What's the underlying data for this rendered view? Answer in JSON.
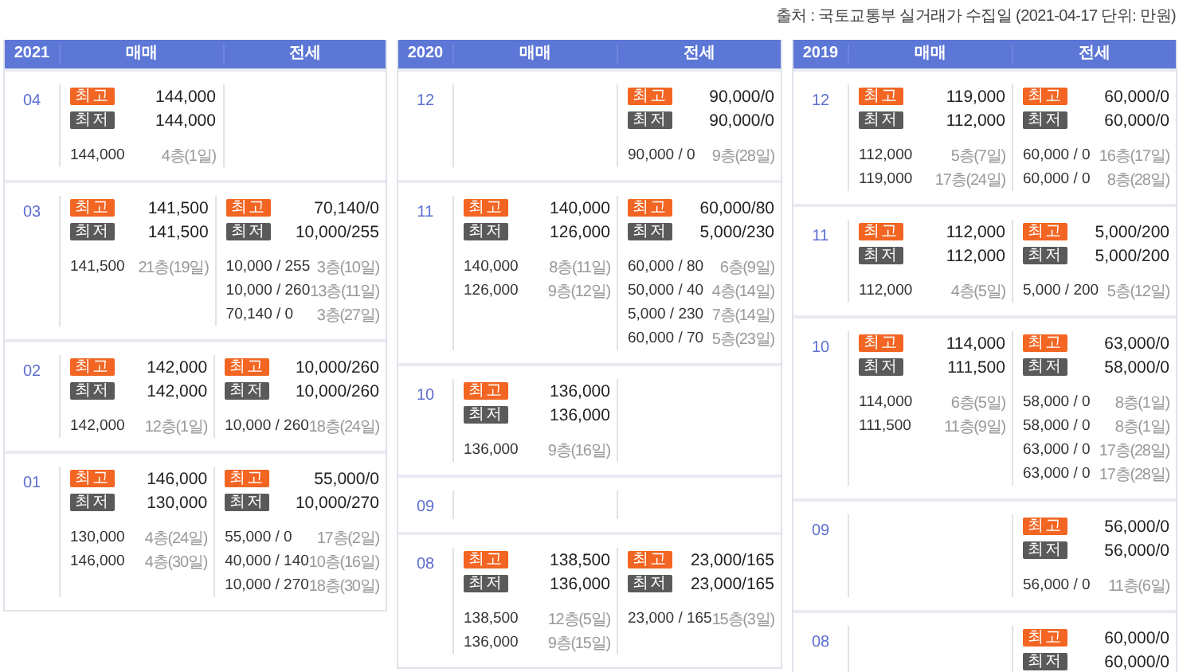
{
  "source": "출처 : 국토교통부 실거래가 수집일 (2021-04-17 단위: 만원)",
  "panels": [
    {
      "header": {
        "year": "2021",
        "sale": "매매",
        "rent": "전세"
      },
      "months": [
        {
          "month": "04",
          "sale": {
            "badges": [
              {
                "kind": "high",
                "label": "최고",
                "value": "144,000"
              },
              {
                "kind": "low",
                "label": "최저",
                "value": "144,000"
              }
            ],
            "deals": [
              {
                "price": "144,000",
                "floor": "4층(1일)"
              }
            ]
          }
        },
        {
          "month": "03",
          "sale": {
            "badges": [
              {
                "kind": "high",
                "label": "최고",
                "value": "141,500"
              },
              {
                "kind": "low",
                "label": "최저",
                "value": "141,500"
              }
            ],
            "deals": [
              {
                "price": "141,500",
                "floor": "21층(19일)"
              }
            ]
          },
          "rent": {
            "badges": [
              {
                "kind": "high",
                "label": "최고",
                "value": "70,140/0"
              },
              {
                "kind": "low",
                "label": "최저",
                "value": "10,000/255"
              }
            ],
            "deals": [
              {
                "price": "10,000 / 255",
                "floor": "3층(10일)"
              },
              {
                "price": "10,000 / 260",
                "floor": "13층(11일)"
              },
              {
                "price": "70,140 / 0",
                "floor": "3층(27일)"
              }
            ]
          }
        },
        {
          "month": "02",
          "sale": {
            "badges": [
              {
                "kind": "high",
                "label": "최고",
                "value": "142,000"
              },
              {
                "kind": "low",
                "label": "최저",
                "value": "142,000"
              }
            ],
            "deals": [
              {
                "price": "142,000",
                "floor": "12층(1일)"
              }
            ]
          },
          "rent": {
            "badges": [
              {
                "kind": "high",
                "label": "최고",
                "value": "10,000/260"
              },
              {
                "kind": "low",
                "label": "최저",
                "value": "10,000/260"
              }
            ],
            "deals": [
              {
                "price": "10,000 / 260",
                "floor": "18층(24일)"
              }
            ]
          }
        },
        {
          "month": "01",
          "sale": {
            "badges": [
              {
                "kind": "high",
                "label": "최고",
                "value": "146,000"
              },
              {
                "kind": "low",
                "label": "최저",
                "value": "130,000"
              }
            ],
            "deals": [
              {
                "price": "130,000",
                "floor": "4층(24일)"
              },
              {
                "price": "146,000",
                "floor": "4층(30일)"
              }
            ]
          },
          "rent": {
            "badges": [
              {
                "kind": "high",
                "label": "최고",
                "value": "55,000/0"
              },
              {
                "kind": "low",
                "label": "최저",
                "value": "10,000/270"
              }
            ],
            "deals": [
              {
                "price": "55,000 / 0",
                "floor": "17층(2일)"
              },
              {
                "price": "40,000 / 140",
                "floor": "10층(16일)"
              },
              {
                "price": "10,000 / 270",
                "floor": "18층(30일)"
              }
            ]
          }
        }
      ]
    },
    {
      "header": {
        "year": "2020",
        "sale": "매매",
        "rent": "전세"
      },
      "months": [
        {
          "month": "12",
          "rent": {
            "badges": [
              {
                "kind": "high",
                "label": "최고",
                "value": "90,000/0"
              },
              {
                "kind": "low",
                "label": "최저",
                "value": "90,000/0"
              }
            ],
            "deals": [
              {
                "price": "90,000 / 0",
                "floor": "9층(28일)"
              }
            ]
          }
        },
        {
          "month": "11",
          "sale": {
            "badges": [
              {
                "kind": "high",
                "label": "최고",
                "value": "140,000"
              },
              {
                "kind": "low",
                "label": "최저",
                "value": "126,000"
              }
            ],
            "deals": [
              {
                "price": "140,000",
                "floor": "8층(11일)"
              },
              {
                "price": "126,000",
                "floor": "9층(12일)"
              }
            ]
          },
          "rent": {
            "badges": [
              {
                "kind": "high",
                "label": "최고",
                "value": "60,000/80"
              },
              {
                "kind": "low",
                "label": "최저",
                "value": "5,000/230"
              }
            ],
            "deals": [
              {
                "price": "60,000 / 80",
                "floor": "6층(9일)"
              },
              {
                "price": "50,000 / 40",
                "floor": "4층(14일)"
              },
              {
                "price": "5,000 / 230",
                "floor": "7층(14일)"
              },
              {
                "price": "60,000 / 70",
                "floor": "5층(23일)"
              }
            ]
          }
        },
        {
          "month": "10",
          "sale": {
            "badges": [
              {
                "kind": "high",
                "label": "최고",
                "value": "136,000"
              },
              {
                "kind": "low",
                "label": "최저",
                "value": "136,000"
              }
            ],
            "deals": [
              {
                "price": "136,000",
                "floor": "9층(16일)"
              }
            ]
          }
        },
        {
          "month": "09"
        },
        {
          "month": "08",
          "sale": {
            "badges": [
              {
                "kind": "high",
                "label": "최고",
                "value": "138,500"
              },
              {
                "kind": "low",
                "label": "최저",
                "value": "136,000"
              }
            ],
            "deals": [
              {
                "price": "138,500",
                "floor": "12층(5일)"
              },
              {
                "price": "136,000",
                "floor": "9층(15일)"
              }
            ]
          },
          "rent": {
            "badges": [
              {
                "kind": "high",
                "label": "최고",
                "value": "23,000/165"
              },
              {
                "kind": "low",
                "label": "최저",
                "value": "23,000/165"
              }
            ],
            "deals": [
              {
                "price": "23,000 / 165",
                "floor": "15층(3일)"
              }
            ]
          }
        }
      ]
    },
    {
      "header": {
        "year": "2019",
        "sale": "매매",
        "rent": "전세"
      },
      "months": [
        {
          "month": "12",
          "sale": {
            "badges": [
              {
                "kind": "high",
                "label": "최고",
                "value": "119,000"
              },
              {
                "kind": "low",
                "label": "최저",
                "value": "112,000"
              }
            ],
            "deals": [
              {
                "price": "112,000",
                "floor": "5층(7일)"
              },
              {
                "price": "119,000",
                "floor": "17층(24일)"
              }
            ]
          },
          "rent": {
            "badges": [
              {
                "kind": "high",
                "label": "최고",
                "value": "60,000/0"
              },
              {
                "kind": "low",
                "label": "최저",
                "value": "60,000/0"
              }
            ],
            "deals": [
              {
                "price": "60,000 / 0",
                "floor": "16층(17일)"
              },
              {
                "price": "60,000 / 0",
                "floor": "8층(28일)"
              }
            ]
          }
        },
        {
          "month": "11",
          "sale": {
            "badges": [
              {
                "kind": "high",
                "label": "최고",
                "value": "112,000"
              },
              {
                "kind": "low",
                "label": "최저",
                "value": "112,000"
              }
            ],
            "deals": [
              {
                "price": "112,000",
                "floor": "4층(5일)"
              }
            ]
          },
          "rent": {
            "badges": [
              {
                "kind": "high",
                "label": "최고",
                "value": "5,000/200"
              },
              {
                "kind": "low",
                "label": "최저",
                "value": "5,000/200"
              }
            ],
            "deals": [
              {
                "price": "5,000 / 200",
                "floor": "5층(12일)"
              }
            ]
          }
        },
        {
          "month": "10",
          "sale": {
            "badges": [
              {
                "kind": "high",
                "label": "최고",
                "value": "114,000"
              },
              {
                "kind": "low",
                "label": "최저",
                "value": "111,500"
              }
            ],
            "deals": [
              {
                "price": "114,000",
                "floor": "6층(5일)"
              },
              {
                "price": "111,500",
                "floor": "11층(9일)"
              }
            ]
          },
          "rent": {
            "badges": [
              {
                "kind": "high",
                "label": "최고",
                "value": "63,000/0"
              },
              {
                "kind": "low",
                "label": "최저",
                "value": "58,000/0"
              }
            ],
            "deals": [
              {
                "price": "58,000 / 0",
                "floor": "8층(1일)"
              },
              {
                "price": "58,000 / 0",
                "floor": "8층(1일)"
              },
              {
                "price": "63,000 / 0",
                "floor": "17층(28일)"
              },
              {
                "price": "63,000 / 0",
                "floor": "17층(28일)"
              }
            ]
          }
        },
        {
          "month": "09",
          "rent": {
            "badges": [
              {
                "kind": "high",
                "label": "최고",
                "value": "56,000/0"
              },
              {
                "kind": "low",
                "label": "최저",
                "value": "56,000/0"
              }
            ],
            "deals": [
              {
                "price": "56,000 / 0",
                "floor": "11층(6일)"
              }
            ]
          }
        },
        {
          "month": "08",
          "rent": {
            "badges": [
              {
                "kind": "high",
                "label": "최고",
                "value": "60,000/0"
              },
              {
                "kind": "low",
                "label": "최저",
                "value": "60,000/0"
              }
            ]
          }
        }
      ]
    }
  ]
}
